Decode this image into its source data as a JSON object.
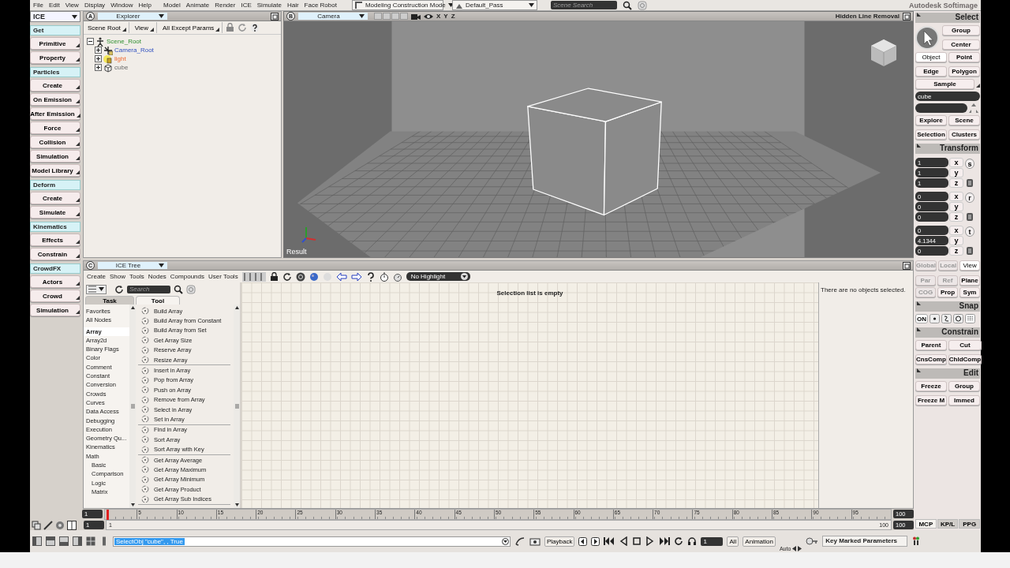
{
  "menubar": {
    "menus": [
      "File",
      "Edit",
      "View",
      "Display",
      "Window",
      "Help"
    ],
    "modules": [
      "Model",
      "Animate",
      "Render",
      "ICE",
      "Simulate",
      "Hair",
      "Face Robot"
    ],
    "mode": "Modeling Construction Mode",
    "pass": "Default_Pass",
    "search": {
      "placeholder": "Scene Search"
    },
    "app_title": "Autodesk Softimage"
  },
  "toolbar": {
    "title": "ICE",
    "items": [
      {
        "kind": "header",
        "label": "Get"
      },
      {
        "kind": "button",
        "label": "Primitive"
      },
      {
        "kind": "button",
        "label": "Property"
      },
      {
        "kind": "header",
        "label": "Particles"
      },
      {
        "kind": "button",
        "label": "Create"
      },
      {
        "kind": "button",
        "label": "On Emission"
      },
      {
        "kind": "button",
        "label": "After Emission"
      },
      {
        "kind": "button",
        "label": "Force"
      },
      {
        "kind": "button",
        "label": "Collision"
      },
      {
        "kind": "button",
        "label": "Simulation"
      },
      {
        "kind": "button",
        "label": "Model Library"
      },
      {
        "kind": "header",
        "label": "Deform"
      },
      {
        "kind": "button",
        "label": "Create"
      },
      {
        "kind": "button",
        "label": "Simulate"
      },
      {
        "kind": "header",
        "label": "Kinematics"
      },
      {
        "kind": "button",
        "label": "Effects"
      },
      {
        "kind": "button",
        "label": "Constrain"
      },
      {
        "kind": "header",
        "label": "CrowdFX"
      },
      {
        "kind": "button",
        "label": "Actors"
      },
      {
        "kind": "button",
        "label": "Crowd"
      },
      {
        "kind": "button",
        "label": "Simulation"
      }
    ]
  },
  "explorer": {
    "letter": "A",
    "title": "Explorer",
    "buttons": [
      "Scene Root",
      "View",
      "All Except Params"
    ],
    "tree": [
      {
        "label": "Scene_Root",
        "kind": "root",
        "expanded": true,
        "children": [
          {
            "label": "Camera_Root",
            "kind": "camera",
            "expanded": false
          },
          {
            "label": "light",
            "kind": "light",
            "expanded": false
          },
          {
            "label": "cube",
            "kind": "mesh",
            "expanded": false
          }
        ]
      }
    ]
  },
  "viewport": {
    "letter": "B",
    "title": "Camera",
    "axes": [
      "X",
      "Y",
      "Z"
    ],
    "display_mode": "Hidden Line Removal",
    "pass_label": "Result"
  },
  "ice_tree": {
    "letter": "C",
    "title": "ICE Tree",
    "menus": [
      "Create",
      "Show",
      "Tools",
      "Nodes",
      "Compounds",
      "User Tools"
    ],
    "highlight": "No Highlight",
    "search": {
      "placeholder": "Search"
    },
    "tabs": [
      {
        "label": "Task",
        "selected": false
      },
      {
        "label": "Tool",
        "selected": true
      }
    ],
    "category_groups": [
      [
        {
          "label": "Favorites",
          "selected": false
        },
        {
          "label": "All Nodes",
          "selected": false
        }
      ],
      [
        {
          "label": "Array",
          "selected": true
        },
        {
          "label": "Array2d",
          "selected": false
        },
        {
          "label": "Binary Flags",
          "selected": false
        },
        {
          "label": "Color",
          "selected": false
        },
        {
          "label": "Comment",
          "selected": false
        },
        {
          "label": "Constant",
          "selected": false
        },
        {
          "label": "Conversion",
          "selected": false
        },
        {
          "label": "Crowds",
          "selected": false
        },
        {
          "label": "Curves",
          "selected": false
        },
        {
          "label": "Data Access",
          "selected": false
        },
        {
          "label": "Debugging",
          "selected": false
        },
        {
          "label": "Execution",
          "selected": false
        },
        {
          "label": "Geometry Qu...",
          "selected": false
        },
        {
          "label": "Kinematics",
          "selected": false
        },
        {
          "label": "Math",
          "selected": false,
          "children": [
            {
              "label": "Basic",
              "selected": false
            },
            {
              "label": "Comparison",
              "selected": false
            },
            {
              "label": "Logic",
              "selected": false
            },
            {
              "label": "Matrix",
              "selected": false
            }
          ]
        }
      ]
    ],
    "node_groups": [
      [
        "Build Array",
        "Build Array from Constant",
        "Build Array from Set",
        "Get Array Size",
        "Reserve Array",
        "Resize Array"
      ],
      [
        "Insert in Array",
        "Pop from Array",
        "Push on Array",
        "Remove from Array",
        "Select in Array",
        "Set in Array"
      ],
      [
        "Find in Array",
        "Sort Array",
        "Sort Array with Key"
      ],
      [
        "Get Array Average",
        "Get Array Maximum",
        "Get Array Minimum",
        "Get Array Product",
        "Get Array Sub Indices"
      ]
    ],
    "canvas_message": "Selection list is empty",
    "property_message": "There are no objects selected."
  },
  "timeline": {
    "start": "1",
    "ticks": [
      "5",
      "10",
      "15",
      "20",
      "25",
      "30",
      "35",
      "40",
      "45",
      "50",
      "55",
      "60",
      "65",
      "70",
      "75",
      "80",
      "85",
      "90",
      "95"
    ],
    "end": "100",
    "range_start": "1",
    "range_label_start": "1",
    "range_label_end": "100",
    "range_end": "100"
  },
  "command_bar": {
    "command": "SelectObj \"cube\", , True",
    "playback": "Playback",
    "frame": "1",
    "all": "All",
    "animation": "Animation",
    "auto": "Auto",
    "key_field": "Key Marked Parameters"
  },
  "mcp": {
    "tabs": [
      {
        "label": "MCP",
        "selected": true
      },
      {
        "label": "KP/L",
        "selected": false
      },
      {
        "label": "PPG",
        "selected": false
      }
    ],
    "select": {
      "title": "Select",
      "top_buttons": [
        "Group",
        "Center"
      ],
      "modes": [
        {
          "label": "Object",
          "selected": true
        },
        {
          "label": "Point",
          "selected": false
        },
        {
          "label": "Edge",
          "selected": false
        },
        {
          "label": "Polygon",
          "selected": false
        }
      ],
      "sample": "Sample",
      "name_field": "cube",
      "buttons": [
        "Explore",
        "Scene",
        "Selection",
        "Clusters"
      ]
    },
    "transform": {
      "title": "Transform",
      "groups": [
        {
          "label": "s",
          "rows": [
            {
              "axis": "x",
              "value": "1"
            },
            {
              "axis": "y",
              "value": "1"
            },
            {
              "axis": "z",
              "value": "1"
            }
          ]
        },
        {
          "label": "r",
          "rows": [
            {
              "axis": "x",
              "value": "0"
            },
            {
              "axis": "y",
              "value": "0"
            },
            {
              "axis": "z",
              "value": "0"
            }
          ]
        },
        {
          "label": "t",
          "rows": [
            {
              "axis": "x",
              "value": "0"
            },
            {
              "axis": "y",
              "value": "4.1344"
            },
            {
              "axis": "z",
              "value": "0"
            }
          ]
        }
      ],
      "reference": [
        {
          "label": "Global",
          "selected": false
        },
        {
          "label": "Local",
          "selected": false
        },
        {
          "label": "View",
          "selected": true
        }
      ],
      "toggles": [
        {
          "label": "Par",
          "on": false
        },
        {
          "label": "Ref",
          "on": false
        },
        {
          "label": "Plane",
          "on": true
        },
        {
          "label": "COG",
          "on": false
        },
        {
          "label": "Prop",
          "on": true
        },
        {
          "label": "Sym",
          "on": true
        }
      ]
    },
    "snap": {
      "title": "Snap",
      "on_label": "ON"
    },
    "constrain": {
      "title": "Constrain",
      "buttons": [
        "Parent",
        "Cut",
        "CnsComp",
        "ChldComp"
      ]
    },
    "edit": {
      "title": "Edit",
      "buttons": [
        "Freeze",
        "Group",
        "Freeze M",
        "Immed"
      ]
    }
  }
}
